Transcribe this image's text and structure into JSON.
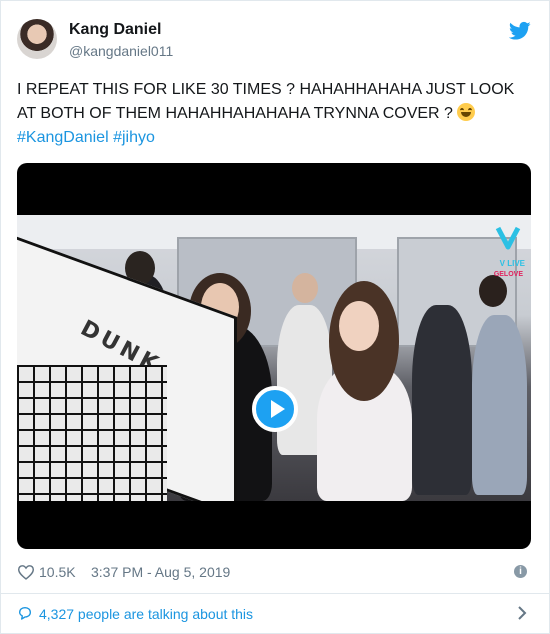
{
  "tweet": {
    "author_name": "Kang Daniel",
    "author_handle": "@kangdaniel011",
    "text_main": "I REPEAT THIS FOR LIKE 30 TIMES ? HAHAHHAHAHA JUST LOOK AT BOTH OF THEM HAHAHHAHAHAHA TRYNNA COVER ? ",
    "hashtags": [
      "#KangDaniel",
      "#jihyo"
    ],
    "likes": "10.5K",
    "timestamp": "3:37 PM - Aug 5, 2019",
    "talking": "4,327 people are talking about this"
  },
  "video": {
    "overlay_sign_text": "DUNK",
    "watermark_text": "V LIVE",
    "corner_text": "GELOVE"
  },
  "colors": {
    "link": "#1b95e0",
    "twitter_blue": "#1da1f2",
    "text": "#14171a",
    "muted": "#657786"
  },
  "icons": [
    "twitter-bird-icon",
    "play-icon",
    "heart-icon",
    "info-icon",
    "comment-bubble-icon",
    "chevron-right-icon",
    "vlive-logo-icon"
  ]
}
